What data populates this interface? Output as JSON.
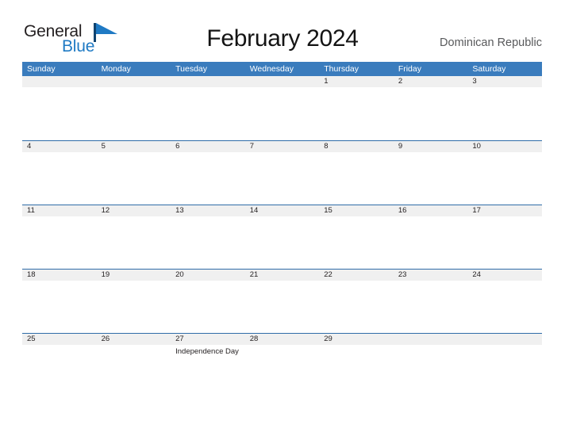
{
  "branding": {
    "logo_primary": "General",
    "logo_secondary": "Blue",
    "flag_icon": "blue-flag-icon",
    "accent_color": "#1f7ac4"
  },
  "header": {
    "title": "February 2024",
    "region": "Dominican Republic"
  },
  "calendar": {
    "month": "February",
    "year": "2024",
    "header_bg_color": "#3a7cbd",
    "row_divider_color": "#2f6ca8",
    "date_band_color": "#f0f0f0",
    "weekdays": [
      "Sunday",
      "Monday",
      "Tuesday",
      "Wednesday",
      "Thursday",
      "Friday",
      "Saturday"
    ],
    "weeks": [
      [
        {
          "day": "",
          "event": ""
        },
        {
          "day": "",
          "event": ""
        },
        {
          "day": "",
          "event": ""
        },
        {
          "day": "",
          "event": ""
        },
        {
          "day": "1",
          "event": ""
        },
        {
          "day": "2",
          "event": ""
        },
        {
          "day": "3",
          "event": ""
        }
      ],
      [
        {
          "day": "4",
          "event": ""
        },
        {
          "day": "5",
          "event": ""
        },
        {
          "day": "6",
          "event": ""
        },
        {
          "day": "7",
          "event": ""
        },
        {
          "day": "8",
          "event": ""
        },
        {
          "day": "9",
          "event": ""
        },
        {
          "day": "10",
          "event": ""
        }
      ],
      [
        {
          "day": "11",
          "event": ""
        },
        {
          "day": "12",
          "event": ""
        },
        {
          "day": "13",
          "event": ""
        },
        {
          "day": "14",
          "event": ""
        },
        {
          "day": "15",
          "event": ""
        },
        {
          "day": "16",
          "event": ""
        },
        {
          "day": "17",
          "event": ""
        }
      ],
      [
        {
          "day": "18",
          "event": ""
        },
        {
          "day": "19",
          "event": ""
        },
        {
          "day": "20",
          "event": ""
        },
        {
          "day": "21",
          "event": ""
        },
        {
          "day": "22",
          "event": ""
        },
        {
          "day": "23",
          "event": ""
        },
        {
          "day": "24",
          "event": ""
        }
      ],
      [
        {
          "day": "25",
          "event": ""
        },
        {
          "day": "26",
          "event": ""
        },
        {
          "day": "27",
          "event": "Independence Day"
        },
        {
          "day": "28",
          "event": ""
        },
        {
          "day": "29",
          "event": ""
        },
        {
          "day": "",
          "event": ""
        },
        {
          "day": "",
          "event": ""
        }
      ]
    ]
  }
}
